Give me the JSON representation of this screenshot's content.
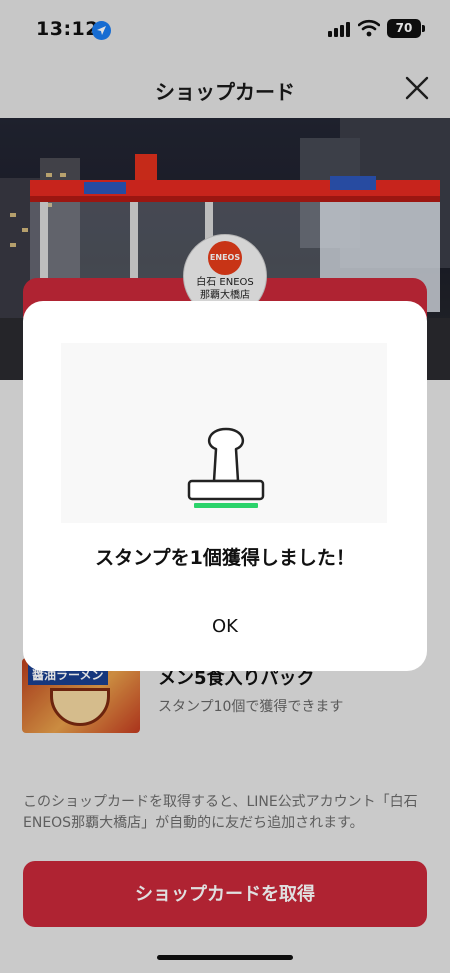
{
  "status": {
    "time": "13:12",
    "battery": "70"
  },
  "nav": {
    "title": "ショップカード"
  },
  "shop": {
    "logo_brand": "ENEOS",
    "logo_name_line1": "白石 ENEOS",
    "logo_name_line2": "那覇大橋店"
  },
  "reward": {
    "image_label": "醤油ラーメン",
    "title": "メン5食入りパック",
    "subtitle": "スタンプ10個で獲得できます"
  },
  "notice": "このショップカードを取得すると、LINE公式アカウント「白石ENEOS那覇大橋店」が自動的に友だち追加されます。",
  "cta_label": "ショップカードを取得",
  "dialog": {
    "message": "スタンプを1個獲得しました！",
    "ok_label": "OK"
  },
  "colors": {
    "accent_red": "#c8283a",
    "stamp_green": "#2bd36b"
  }
}
